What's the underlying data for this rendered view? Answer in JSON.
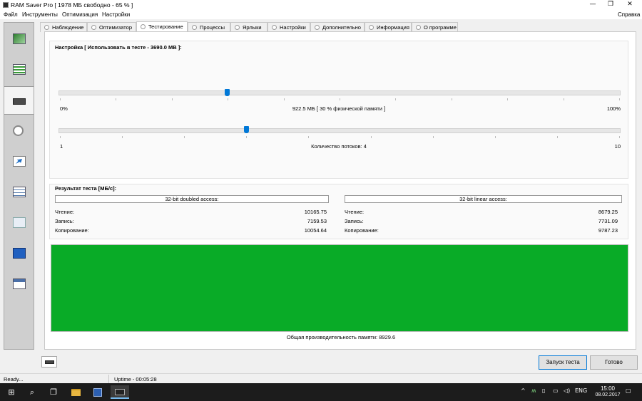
{
  "window": {
    "title": "RAM Saver Pro [ 1978 МБ свободно - 65 % ]",
    "minimize": "—",
    "maximize": "❐",
    "close": "✕"
  },
  "menu": {
    "items": [
      "Файл",
      "Инструменты",
      "Оптимизация",
      "Настройки"
    ],
    "help": "Справка"
  },
  "sidebar": {
    "items": [
      {
        "icon": "monitor-icon"
      },
      {
        "icon": "list-icon"
      },
      {
        "icon": "ram-module-icon",
        "active": true
      },
      {
        "icon": "magnifier-icon"
      },
      {
        "icon": "shortcut-arrow-icon"
      },
      {
        "icon": "checklist-icon"
      },
      {
        "icon": "settings-window-icon"
      },
      {
        "icon": "info-icon"
      },
      {
        "icon": "about-card-icon"
      }
    ]
  },
  "tabs": [
    {
      "label": "Наблюдение"
    },
    {
      "label": "Оптимизатор"
    },
    {
      "label": "Тестирование",
      "active": true
    },
    {
      "label": "Процессы"
    },
    {
      "label": "Ярлыки"
    },
    {
      "label": "Настройки"
    },
    {
      "label": "Дополнительно"
    },
    {
      "label": "Информация"
    },
    {
      "label": "О программе"
    }
  ],
  "settings": {
    "title": "Настройка [ Использовать в тесте - 3690.0 MB ]:",
    "memory_slider": {
      "min_label": "0%",
      "max_label": "100%",
      "value_label": "922.5 МБ [ 30 % физической памяти ]",
      "value": 30
    },
    "threads_slider": {
      "min_label": "1",
      "max_label": "10",
      "value_label": "Количество потоков: 4",
      "value": 4,
      "min": 1,
      "max": 10
    }
  },
  "results": {
    "title": "Результат теста [МБ/с]:",
    "doubled": {
      "header": "32-bit doubled access:",
      "read_label": "Чтение:",
      "read": "10165.75",
      "write_label": "Запись:",
      "write": "7159.53",
      "copy_label": "Копирование:",
      "copy": "10054.64"
    },
    "linear": {
      "header": "32-bit linear access:",
      "read_label": "Чтение:",
      "read": "8679.25",
      "write_label": "Запись:",
      "write": "7731.09",
      "copy_label": "Копирование:",
      "copy": "9787.23"
    },
    "bar_color": "#09ab27",
    "overall": "Общая производительность памяти: 8929.6"
  },
  "buttons": {
    "start": "Запуск теста",
    "done": "Готово"
  },
  "status": {
    "left": "Ready...",
    "uptime": "Uptime - 00:05:28"
  },
  "taskbar": {
    "start_icon": "⊞",
    "search_icon": "⌕",
    "taskview_icon": "❐",
    "tray_lang": "ENG",
    "time": "15:00",
    "date": "08.02.2017"
  }
}
